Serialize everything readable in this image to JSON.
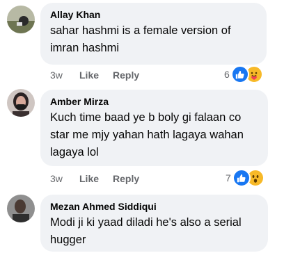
{
  "comments": [
    {
      "author": "Allay Khan",
      "text": "sahar hashmi is a female version of imran hashmi",
      "time": "3w",
      "like_label": "Like",
      "reply_label": "Reply",
      "reaction_count": "6",
      "reactions": [
        "like-icon",
        "care-icon"
      ]
    },
    {
      "author": "Amber Mirza",
      "text": "Kuch time baad ye b boly gi falaan co star me mjy yahan hath lagaya wahan lagaya lol",
      "time": "3w",
      "like_label": "Like",
      "reply_label": "Reply",
      "reaction_count": "7",
      "reactions": [
        "like-icon",
        "wow-icon"
      ]
    },
    {
      "author": "Mezan Ahmed Siddiqui",
      "text": "Modi ji ki yaad diladi he's also a serial hugger"
    }
  ],
  "colors": {
    "bubble": "#f0f2f5",
    "meta_text": "#65676b",
    "like_blue": "#1877f2",
    "emoji_yellow": "#f7b928"
  }
}
